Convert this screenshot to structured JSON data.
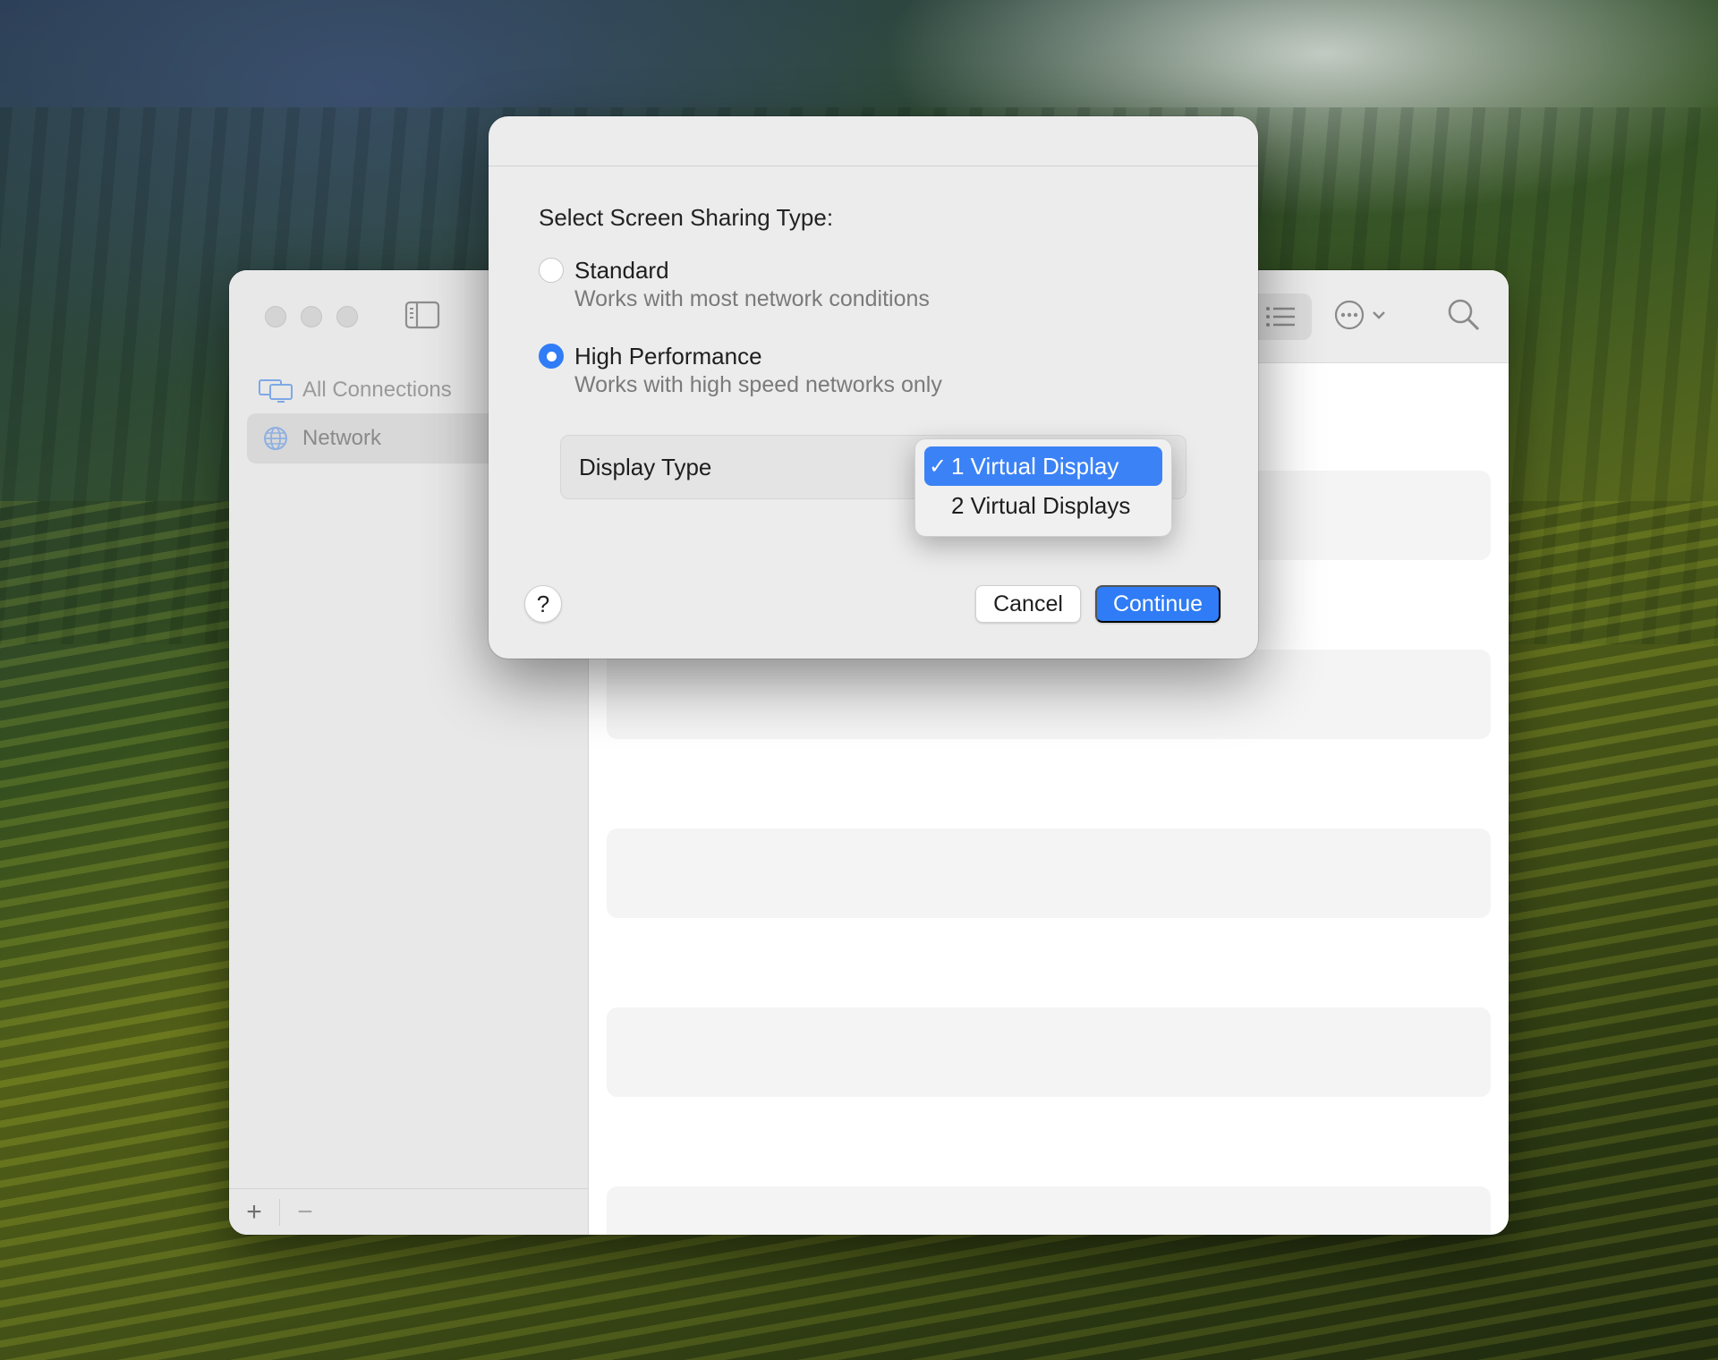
{
  "sidebar": {
    "items": [
      {
        "label": "All Connections",
        "icon": "displays-icon"
      },
      {
        "label": "Network",
        "icon": "globe-icon"
      }
    ],
    "footer": {
      "add_label": "+",
      "remove_label": "−"
    }
  },
  "toolbar": {
    "icons": [
      "list-view-icon",
      "more-options-icon",
      "chevron-down-icon",
      "search-icon"
    ]
  },
  "dialog": {
    "prompt": "Select Screen Sharing Type:",
    "options": [
      {
        "title": "Standard",
        "subtitle": "Works with most network conditions",
        "selected": false
      },
      {
        "title": "High Performance",
        "subtitle": "Works with high speed networks only",
        "selected": true
      }
    ],
    "display_type_label": "Display Type",
    "display_menu": [
      {
        "label": "1 Virtual Display",
        "checked": true
      },
      {
        "label": "2 Virtual Displays",
        "checked": false
      }
    ],
    "check_glyph": "✓",
    "help_label": "?",
    "cancel_label": "Cancel",
    "continue_label": "Continue"
  },
  "colors": {
    "accent": "#2f7cf6",
    "menu_highlight": "#3b82f6"
  }
}
